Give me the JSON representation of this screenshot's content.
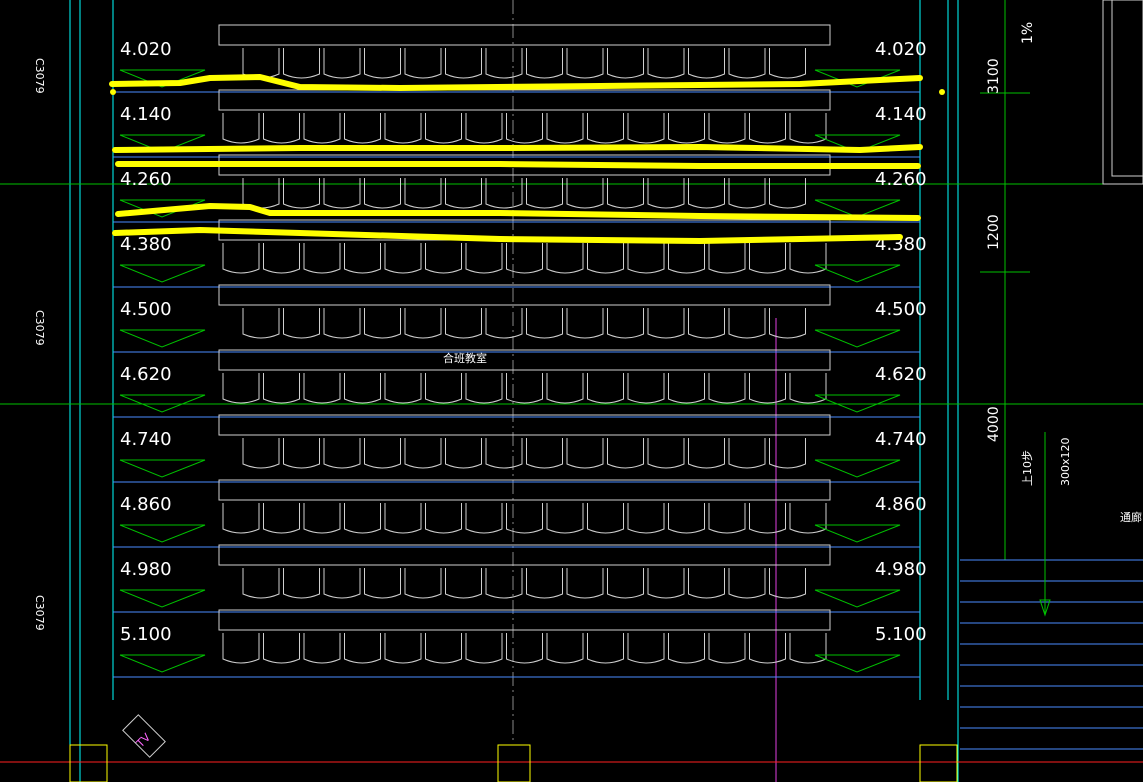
{
  "drawing": {
    "room_label": "合班教室",
    "left_door_label": "C3079",
    "right_corridor_label": "通廊",
    "slope_label": "1%",
    "stair_label": "上10步",
    "stair_size_label": "300x120",
    "tv_label": "TV",
    "dimensions": [
      "3100",
      "1200",
      "4000"
    ],
    "levels": [
      "4.020",
      "4.140",
      "4.260",
      "4.380",
      "4.500",
      "4.620",
      "4.740",
      "4.860",
      "4.980",
      "5.100"
    ]
  },
  "colors": {
    "background": "#000000",
    "highlight": "#ffff00",
    "row_line": "#4a8cff",
    "wall_line": "#00ffff",
    "green_line": "#00c000",
    "seat_line": "#cfcfcf",
    "magenta_line": "#e040e0",
    "red_line": "#ff2020",
    "yellow_wall": "#ffff00"
  }
}
